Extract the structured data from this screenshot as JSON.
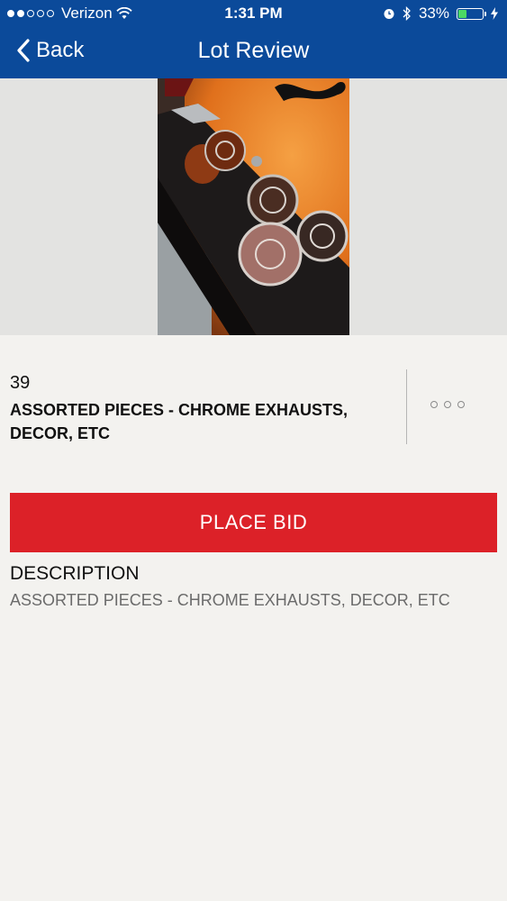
{
  "status_bar": {
    "carrier": "Verizon",
    "time": "1:31 PM",
    "battery": "33%",
    "battery_level": 0.33
  },
  "nav": {
    "back_label": "Back",
    "title": "Lot Review"
  },
  "lot": {
    "number": "39",
    "title": "ASSORTED PIECES - CHROME EXHAUSTS, DECOR, ETC"
  },
  "actions": {
    "place_bid_label": "PLACE BID"
  },
  "description": {
    "heading": "DESCRIPTION",
    "text": "ASSORTED PIECES - CHROME EXHAUSTS, DECOR, ETC"
  },
  "colors": {
    "header": "#0b4a9a",
    "bid_button": "#dc2128",
    "background": "#f3f2ef"
  }
}
